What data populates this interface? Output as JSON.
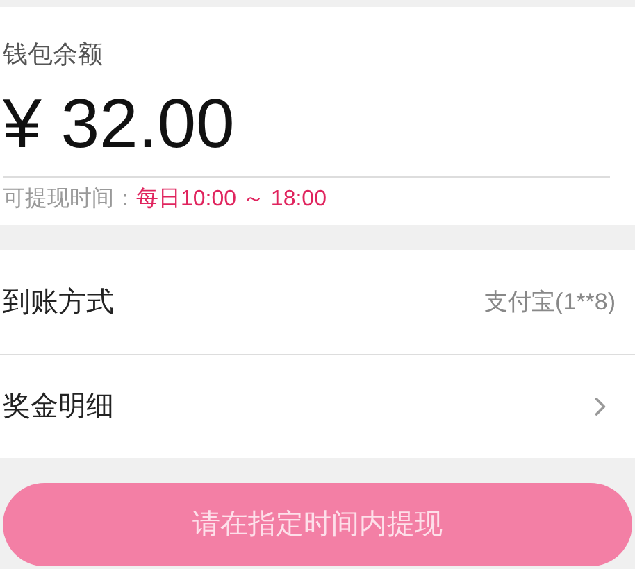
{
  "wallet": {
    "label": "钱包余额",
    "amount": "¥ 32.00",
    "time_label": "可提现时间：",
    "time_value": "每日10:00 ～ 18:00"
  },
  "rows": [
    {
      "kind": "value",
      "label": "到账方式",
      "value": "支付宝(1**8)"
    },
    {
      "kind": "link",
      "label": "奖金明细"
    }
  ],
  "submit": {
    "label": "请在指定时间内提现",
    "disabled": true
  }
}
